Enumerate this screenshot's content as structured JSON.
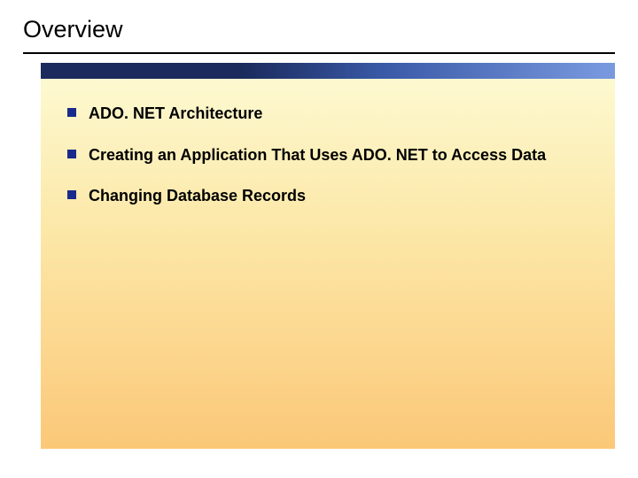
{
  "title": "Overview",
  "bullets": [
    {
      "text": "ADO. NET Architecture"
    },
    {
      "text": "Creating an Application That Uses ADO. NET to Access Data"
    },
    {
      "text": "Changing Database Records"
    }
  ]
}
